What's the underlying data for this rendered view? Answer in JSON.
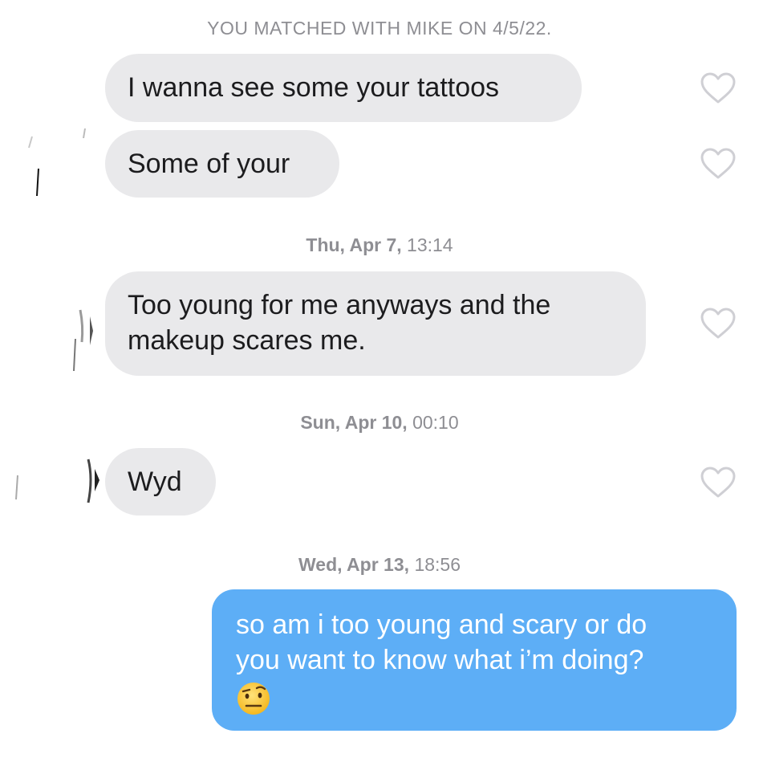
{
  "header": {
    "match_text": "YOU MATCHED WITH MIKE ON 4/5/22."
  },
  "messages": [
    {
      "id": "m1",
      "text": "I wanna see some your tattoos"
    },
    {
      "id": "m2",
      "text": "Some of your"
    },
    {
      "id": "m3",
      "line1": "Too young for me anyways and the",
      "line2": "makeup scares me."
    },
    {
      "id": "m4",
      "text": "Wyd"
    },
    {
      "id": "m5",
      "line1": "so am i too young and scary or do",
      "line2": "you want to know what i’m doing?"
    }
  ],
  "timestamps": [
    {
      "day": "Thu, Apr 7,",
      "time": "13:14"
    },
    {
      "day": "Sun, Apr 10,",
      "time": "00:10"
    },
    {
      "day": "Wed, Apr 13,",
      "time": "18:56"
    }
  ],
  "icons": {
    "like": "heart-outline-icon",
    "emoji": "raised-eyebrow-face-emoji"
  },
  "colors": {
    "incoming_bubble": "#e9e9eb",
    "outgoing_bubble": "#5daef6",
    "meta_text": "#8e8e93",
    "heart_outline": "#cfcfd4"
  }
}
